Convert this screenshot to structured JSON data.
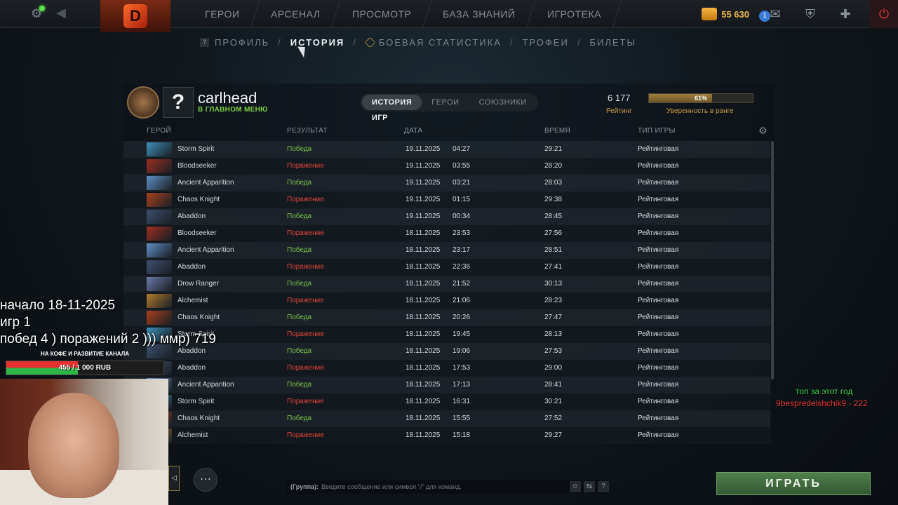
{
  "topbar": {
    "nav": [
      "ГЕРОИ",
      "АРСЕНАЛ",
      "ПРОСМОТР",
      "БАЗА ЗНАНИЙ",
      "ИГРОТЕКА"
    ],
    "coins": "55 630",
    "messages_badge": "1"
  },
  "subnav": {
    "profile": "ПРОФИЛЬ",
    "history": "ИСТОРИЯ",
    "stats": "БОЕВАЯ СТАТИСТИКА",
    "trophies": "ТРОФЕИ",
    "tickets": "БИЛЕТЫ",
    "separator": "/"
  },
  "profile": {
    "avatar": "?",
    "username": "carlhead",
    "status": "В ГЛАВНОМ МЕНЮ",
    "rating_value": "6 177",
    "rating_label": "Рейтинг",
    "confidence_value": 0.61,
    "confidence_text": "61%",
    "confidence_label": "Уверенность в ранге"
  },
  "tabs": [
    "ИСТОРИЯ ИГР",
    "ГЕРОИ",
    "СОЮЗНИКИ"
  ],
  "table": {
    "headers": {
      "hero": "ГЕРОЙ",
      "result": "РЕЗУЛЬТАТ",
      "date": "ДАТА",
      "duration": "ВРЕМЯ",
      "mode": "ТИП ИГРЫ"
    },
    "rows": [
      {
        "hero": "Storm Spirit",
        "result": "Победа",
        "win": true,
        "date": "19.11.2025",
        "time": "04:27",
        "duration": "29:21",
        "mode": "Рейтинговая",
        "color": "#3e8fb8"
      },
      {
        "hero": "Bloodseeker",
        "result": "Поражение",
        "win": false,
        "date": "19.11.2025",
        "time": "03:55",
        "duration": "28:20",
        "mode": "Рейтинговая",
        "color": "#9a2e22"
      },
      {
        "hero": "Ancient Apparition",
        "result": "Победа",
        "win": true,
        "date": "19.11.2025",
        "time": "03:21",
        "duration": "28:03",
        "mode": "Рейтинговая",
        "color": "#5f8fc4"
      },
      {
        "hero": "Chaos Knight",
        "result": "Поражение",
        "win": false,
        "date": "19.11.2025",
        "time": "01:15",
        "duration": "29:38",
        "mode": "Рейтинговая",
        "color": "#a8401e"
      },
      {
        "hero": "Abaddon",
        "result": "Победа",
        "win": true,
        "date": "19.11.2025",
        "time": "00:34",
        "duration": "28:45",
        "mode": "Рейтинговая",
        "color": "#3c4f6e"
      },
      {
        "hero": "Bloodseeker",
        "result": "Поражение",
        "win": false,
        "date": "18.11.2025",
        "time": "23:53",
        "duration": "27:56",
        "mode": "Рейтинговая",
        "color": "#9a2e22"
      },
      {
        "hero": "Ancient Apparition",
        "result": "Победа",
        "win": true,
        "date": "18.11.2025",
        "time": "23:17",
        "duration": "28:51",
        "mode": "Рейтинговая",
        "color": "#5f8fc4"
      },
      {
        "hero": "Abaddon",
        "result": "Поражение",
        "win": false,
        "date": "18.11.2025",
        "time": "22:36",
        "duration": "27:41",
        "mode": "Рейтинговая",
        "color": "#3c4f6e"
      },
      {
        "hero": "Drow Ranger",
        "result": "Победа",
        "win": true,
        "date": "18.11.2025",
        "time": "21:52",
        "duration": "30:13",
        "mode": "Рейтинговая",
        "color": "#6a78a8"
      },
      {
        "hero": "Alchemist",
        "result": "Поражение",
        "win": false,
        "date": "18.11.2025",
        "time": "21:06",
        "duration": "28:23",
        "mode": "Рейтинговая",
        "color": "#b07a2e"
      },
      {
        "hero": "Chaos Knight",
        "result": "Победа",
        "win": true,
        "date": "18.11.2025",
        "time": "20:26",
        "duration": "27:47",
        "mode": "Рейтинговая",
        "color": "#a8401e"
      },
      {
        "hero": "Storm Spirit",
        "result": "Поражение",
        "win": false,
        "date": "18.11.2025",
        "time": "19:45",
        "duration": "28:13",
        "mode": "Рейтинговая",
        "color": "#3e8fb8"
      },
      {
        "hero": "Abaddon",
        "result": "Победа",
        "win": true,
        "date": "18.11.2025",
        "time": "19:06",
        "duration": "27:53",
        "mode": "Рейтинговая",
        "color": "#3c4f6e"
      },
      {
        "hero": "Abaddon",
        "result": "Поражение",
        "win": false,
        "date": "18.11.2025",
        "time": "17:53",
        "duration": "29:00",
        "mode": "Рейтинговая",
        "color": "#3c4f6e"
      },
      {
        "hero": "Ancient Apparition",
        "result": "Победа",
        "win": true,
        "date": "18.11.2025",
        "time": "17:13",
        "duration": "28:41",
        "mode": "Рейтинговая",
        "color": "#5f8fc4"
      },
      {
        "hero": "Storm Spirit",
        "result": "Поражение",
        "win": false,
        "date": "18.11.2025",
        "time": "16:31",
        "duration": "30:21",
        "mode": "Рейтинговая",
        "color": "#3e8fb8"
      },
      {
        "hero": "Chaos Knight",
        "result": "Победа",
        "win": true,
        "date": "18.11.2025",
        "time": "15:55",
        "duration": "27:52",
        "mode": "Рейтинговая",
        "color": "#a8401e"
      },
      {
        "hero": "Alchemist",
        "result": "Поражение",
        "win": false,
        "date": "18.11.2025",
        "time": "15:18",
        "duration": "29:27",
        "mode": "Рейтинговая",
        "color": "#b07a2e"
      }
    ]
  },
  "overlay": {
    "line1": "начало 18-11-2025",
    "line2": "игр 1",
    "line3": "побед 4 ) поражений 2 ))) ммр) 719",
    "donation_title": "НА КОФЕ И РАЗВИТИЕ КАНАЛА",
    "donation_text": "455 / 1 000 RUB",
    "donation_progress": 0.455,
    "top_year": "топ за этот год",
    "top_user": "9bespredelshchik9 - 222"
  },
  "chat": {
    "group": "(Группа):",
    "placeholder": "Введите сообщение или символ \"/\" для команд."
  },
  "play_button": "ИГРАТЬ"
}
